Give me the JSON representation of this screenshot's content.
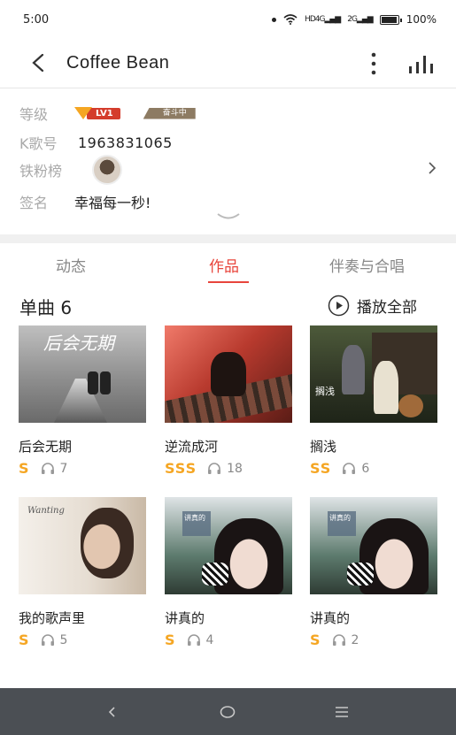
{
  "status_bar": {
    "time": "5:00",
    "net1": "4G",
    "net2": "2G",
    "hd": "HD",
    "battery": "100%",
    "battery_level": 1.0
  },
  "header": {
    "title": "Coffee Bean"
  },
  "profile": {
    "level_label": "等级",
    "level_badge": "LV1",
    "rank_badge": "奋斗中",
    "k_label": "K歌号",
    "k_value": "1963831065",
    "fans_label": "铁粉榜",
    "sign_label": "签名",
    "sign_value": "幸福每一秒!"
  },
  "tabs": [
    {
      "label": "动态",
      "active": false
    },
    {
      "label": "作品",
      "active": true
    },
    {
      "label": "伴奏与合唱",
      "active": false
    }
  ],
  "section": {
    "title": "单曲 6",
    "play_all": "播放全部"
  },
  "songs": [
    {
      "title": "后会无期",
      "grade": "S",
      "plays": "7"
    },
    {
      "title": "逆流成河",
      "grade": "SSS",
      "plays": "18"
    },
    {
      "title": "搁浅",
      "grade": "SS",
      "plays": "6"
    },
    {
      "title": "我的歌声里",
      "grade": "S",
      "plays": "5"
    },
    {
      "title": "讲真的",
      "grade": "S",
      "plays": "4"
    },
    {
      "title": "讲真的",
      "grade": "S",
      "plays": "2"
    }
  ],
  "colors": {
    "accent": "#e8453c",
    "grade": "#f5a623",
    "nav_bar": "#4b4f54"
  },
  "nav_bar": {
    "back": "back-icon",
    "home": "home-icon",
    "menu": "menu-icon"
  }
}
